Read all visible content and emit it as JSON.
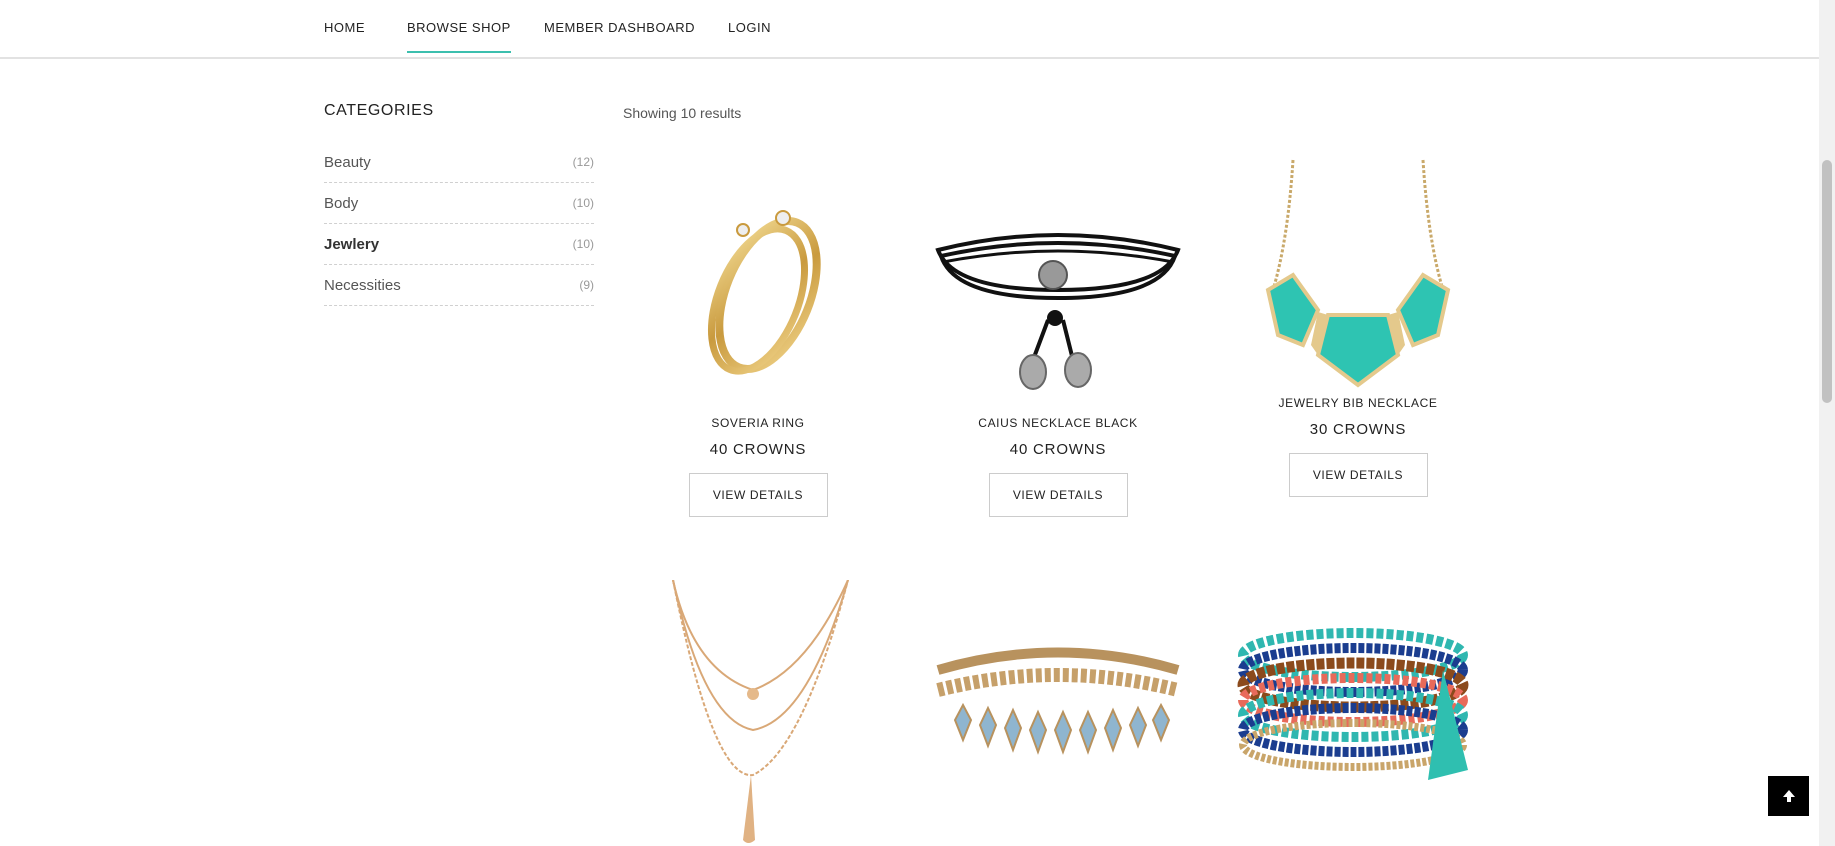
{
  "nav": {
    "items": [
      {
        "label": "HOME",
        "active": false
      },
      {
        "label": "BROWSE SHOP",
        "active": true
      },
      {
        "label": "MEMBER DASHBOARD",
        "active": false
      },
      {
        "label": "LOGIN",
        "active": false
      }
    ],
    "accent_color": "#3cbfae"
  },
  "sidebar": {
    "title": "CATEGORIES",
    "categories": [
      {
        "name": "Beauty",
        "count": "(12)",
        "active": false
      },
      {
        "name": "Body",
        "count": "(10)",
        "active": false
      },
      {
        "name": "Jewlery",
        "count": "(10)",
        "active": true
      },
      {
        "name": "Necessities",
        "count": "(9)",
        "active": false
      }
    ]
  },
  "results": {
    "text": "Showing 10 results"
  },
  "products": [
    {
      "name": "SOVERIA RING",
      "price": "40 CROWNS",
      "button": "VIEW DETAILS",
      "image": "gold-ring-icon"
    },
    {
      "name": "CAIUS NECKLACE BLACK",
      "price": "40 CROWNS",
      "button": "VIEW DETAILS",
      "image": "black-choker-icon"
    },
    {
      "name": "JEWELRY BIB NECKLACE",
      "price": "30 CROWNS",
      "button": "VIEW DETAILS",
      "image": "turquoise-bib-necklace-icon"
    },
    {
      "name": "",
      "price": "",
      "button": "",
      "image": "layered-gold-necklace-icon"
    },
    {
      "name": "",
      "price": "",
      "button": "",
      "image": "beaded-choker-icon"
    },
    {
      "name": "",
      "price": "",
      "button": "",
      "image": "beaded-bracelet-stack-icon"
    }
  ],
  "back_to_top": {
    "icon": "arrow-up-icon"
  }
}
